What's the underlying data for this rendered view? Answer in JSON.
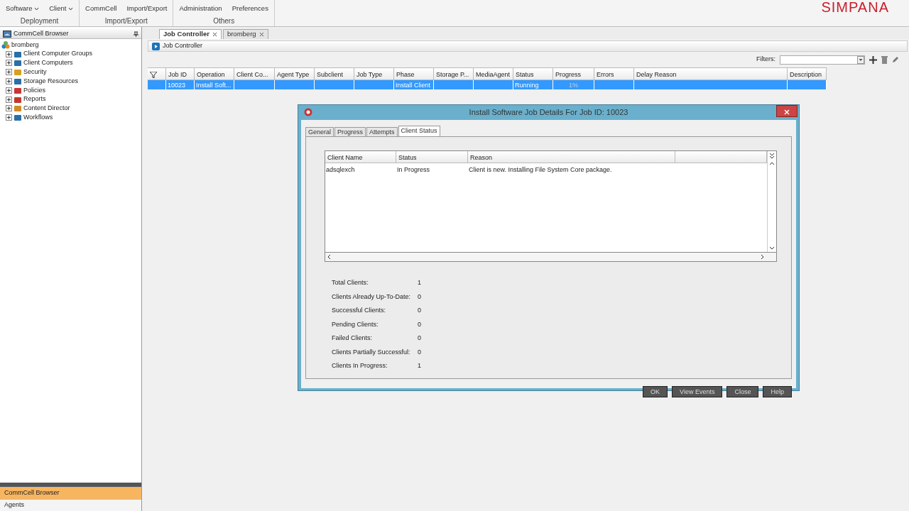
{
  "ribbon": {
    "groups": [
      {
        "label": "Deployment",
        "buttons": [
          {
            "label": "Software",
            "dropdown": true
          },
          {
            "label": "Client",
            "dropdown": true
          }
        ]
      },
      {
        "label": "Import/Export",
        "buttons": [
          {
            "label": "CommCell",
            "dropdown": false
          },
          {
            "label": "Import/Export",
            "dropdown": false
          }
        ]
      },
      {
        "label": "Others",
        "buttons": [
          {
            "label": "Administration",
            "dropdown": false
          },
          {
            "label": "Preferences",
            "dropdown": false
          }
        ]
      }
    ],
    "logo": "SIMPANA"
  },
  "browser": {
    "title": "CommCell Browser",
    "tree": [
      {
        "label": "bromberg",
        "children": [
          {
            "label": "Client Computer Groups",
            "expanded": false
          },
          {
            "label": "Client Computers",
            "expanded": false
          },
          {
            "label": "Security",
            "expanded": false
          },
          {
            "label": "Storage Resources",
            "expanded": false
          },
          {
            "label": "Policies",
            "expanded": false
          },
          {
            "label": "Reports",
            "expanded": false
          },
          {
            "label": "Content Director",
            "expanded": false
          },
          {
            "label": "Workflows",
            "expanded": false
          }
        ]
      }
    ],
    "bottom_nav": [
      {
        "label": "CommCell Browser",
        "selected": true
      },
      {
        "label": "Agents",
        "selected": false
      }
    ]
  },
  "tabs": [
    {
      "label": "Job Controller",
      "selected": true
    },
    {
      "label": "bromberg",
      "selected": false
    }
  ],
  "panel": {
    "title": "Job Controller",
    "filters_label": "Filters:",
    "table": {
      "columns": [
        "Job ID",
        "Operation",
        "Client Co...",
        "Agent Type",
        "Subclient",
        "Job Type",
        "Phase",
        "Storage P...",
        "MediaAgent",
        "Status",
        "Progress",
        "Errors",
        "Delay Reason",
        "Description"
      ],
      "rows": [
        {
          "selected": true,
          "cells": [
            "10023",
            "Install Soft...",
            "",
            "",
            "",
            "",
            "Install Client",
            "",
            "",
            "Running",
            "1%",
            "",
            "",
            ""
          ]
        }
      ]
    }
  },
  "dialog": {
    "title": "Install Software Job Details For Job ID: 10023",
    "tabs": [
      {
        "label": "General",
        "selected": false
      },
      {
        "label": "Progress",
        "selected": false
      },
      {
        "label": "Attempts",
        "selected": false
      },
      {
        "label": "Client Status",
        "selected": true
      }
    ],
    "table": {
      "columns": [
        "Client Name",
        "Status",
        "Reason"
      ],
      "rows": [
        [
          "adsqlexch",
          "In Progress",
          "Client is new. Installing File System Core package."
        ]
      ]
    },
    "summary": [
      {
        "label": "Total Clients:",
        "value": "1"
      },
      {
        "label": "Clients Already Up-To-Date:",
        "value": "0"
      },
      {
        "label": "Successful Clients:",
        "value": "0"
      },
      {
        "label": "Pending Clients:",
        "value": "0"
      },
      {
        "label": "Failed Clients:",
        "value": "0"
      },
      {
        "label": "Clients Partially Successful:",
        "value": "0"
      },
      {
        "label": "Clients In Progress:",
        "value": "1"
      }
    ],
    "buttons": [
      "OK",
      "View Events",
      "Close",
      "Help"
    ]
  }
}
